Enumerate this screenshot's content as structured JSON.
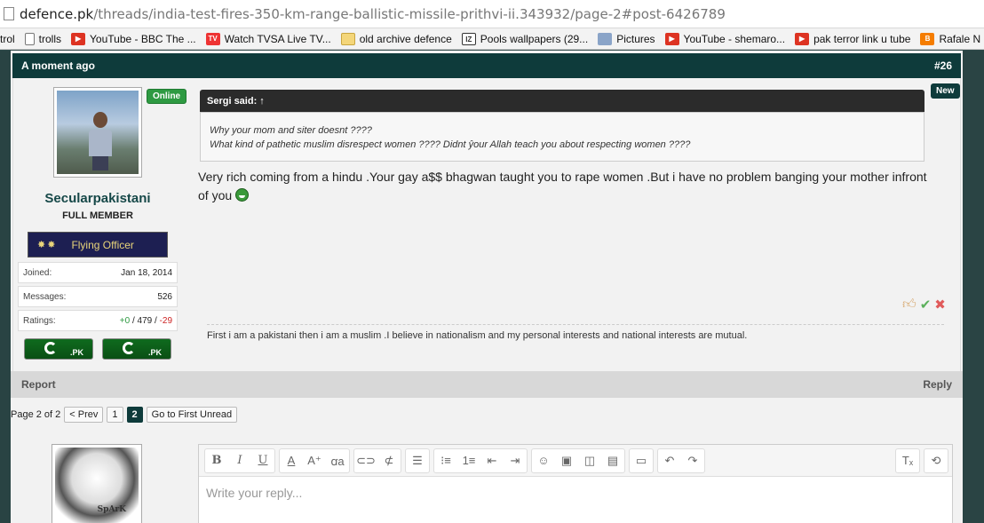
{
  "browser": {
    "url_host": "defence.pk",
    "url_path": "/threads/india-test-fires-350-km-range-ballistic-missile-prithvi-ii.343932/page-2#post-6426789",
    "bookmarks": [
      {
        "label": "trol",
        "icon": "none"
      },
      {
        "label": "trolls",
        "icon": "doc"
      },
      {
        "label": "YouTube - BBC The ...",
        "icon": "yt"
      },
      {
        "label": "Watch TVSA Live TV...",
        "icon": "tv"
      },
      {
        "label": "old archive defence",
        "icon": "folder"
      },
      {
        "label": "Pools wallpapers (29...",
        "icon": "iz"
      },
      {
        "label": "Pictures",
        "icon": "pic"
      },
      {
        "label": "YouTube - shemaro...",
        "icon": "yt"
      },
      {
        "label": "pak terror link u tube",
        "icon": "yt"
      },
      {
        "label": "Rafale N",
        "icon": "blog"
      }
    ]
  },
  "post": {
    "time": "A moment ago",
    "number": "#26",
    "new_label": "New",
    "user": {
      "online": "Online",
      "name": "Secularpakistani",
      "title": "FULL MEMBER",
      "rank_stars": "✸✸",
      "rank": "Flying Officer",
      "joined_label": "Joined:",
      "joined": "Jan 18, 2014",
      "messages_label": "Messages:",
      "messages": "526",
      "ratings_label": "Ratings:",
      "ratings_pos": "+0",
      "ratings_sep1": " / ",
      "ratings_mid": "479",
      "ratings_sep2": " / ",
      "ratings_neg": "-29",
      "flag_text": ".PK"
    },
    "quote_author": "Sergi said: ↑",
    "quote_line1": "Why your mom and siter doesnt ????",
    "quote_line2": "What kind of pathetic muslim disrespect women ???? Didnt ŷour Allah teach you about respecting women ????",
    "message": "Very rich coming from a hindu .Your gay a$$ bhagwan taught you to rape women .But i have no problem banging your mother infront of you ",
    "signature": "First i am a pakistani then i am a muslim .I believe in nationalism and my personal interests and national interests are mutual.",
    "report": "Report",
    "reply": "Reply"
  },
  "pager": {
    "text": "Page 2 of 2",
    "prev": "< Prev",
    "pages": [
      "1",
      "2"
    ],
    "first_unread": "Go to First Unread"
  },
  "editor": {
    "placeholder": "Write your reply...",
    "avatar_text": "SpArK"
  },
  "colors": {
    "header": "#0e3b3b",
    "online": "#2e9a42",
    "rank_bg": "#1d1f52"
  }
}
